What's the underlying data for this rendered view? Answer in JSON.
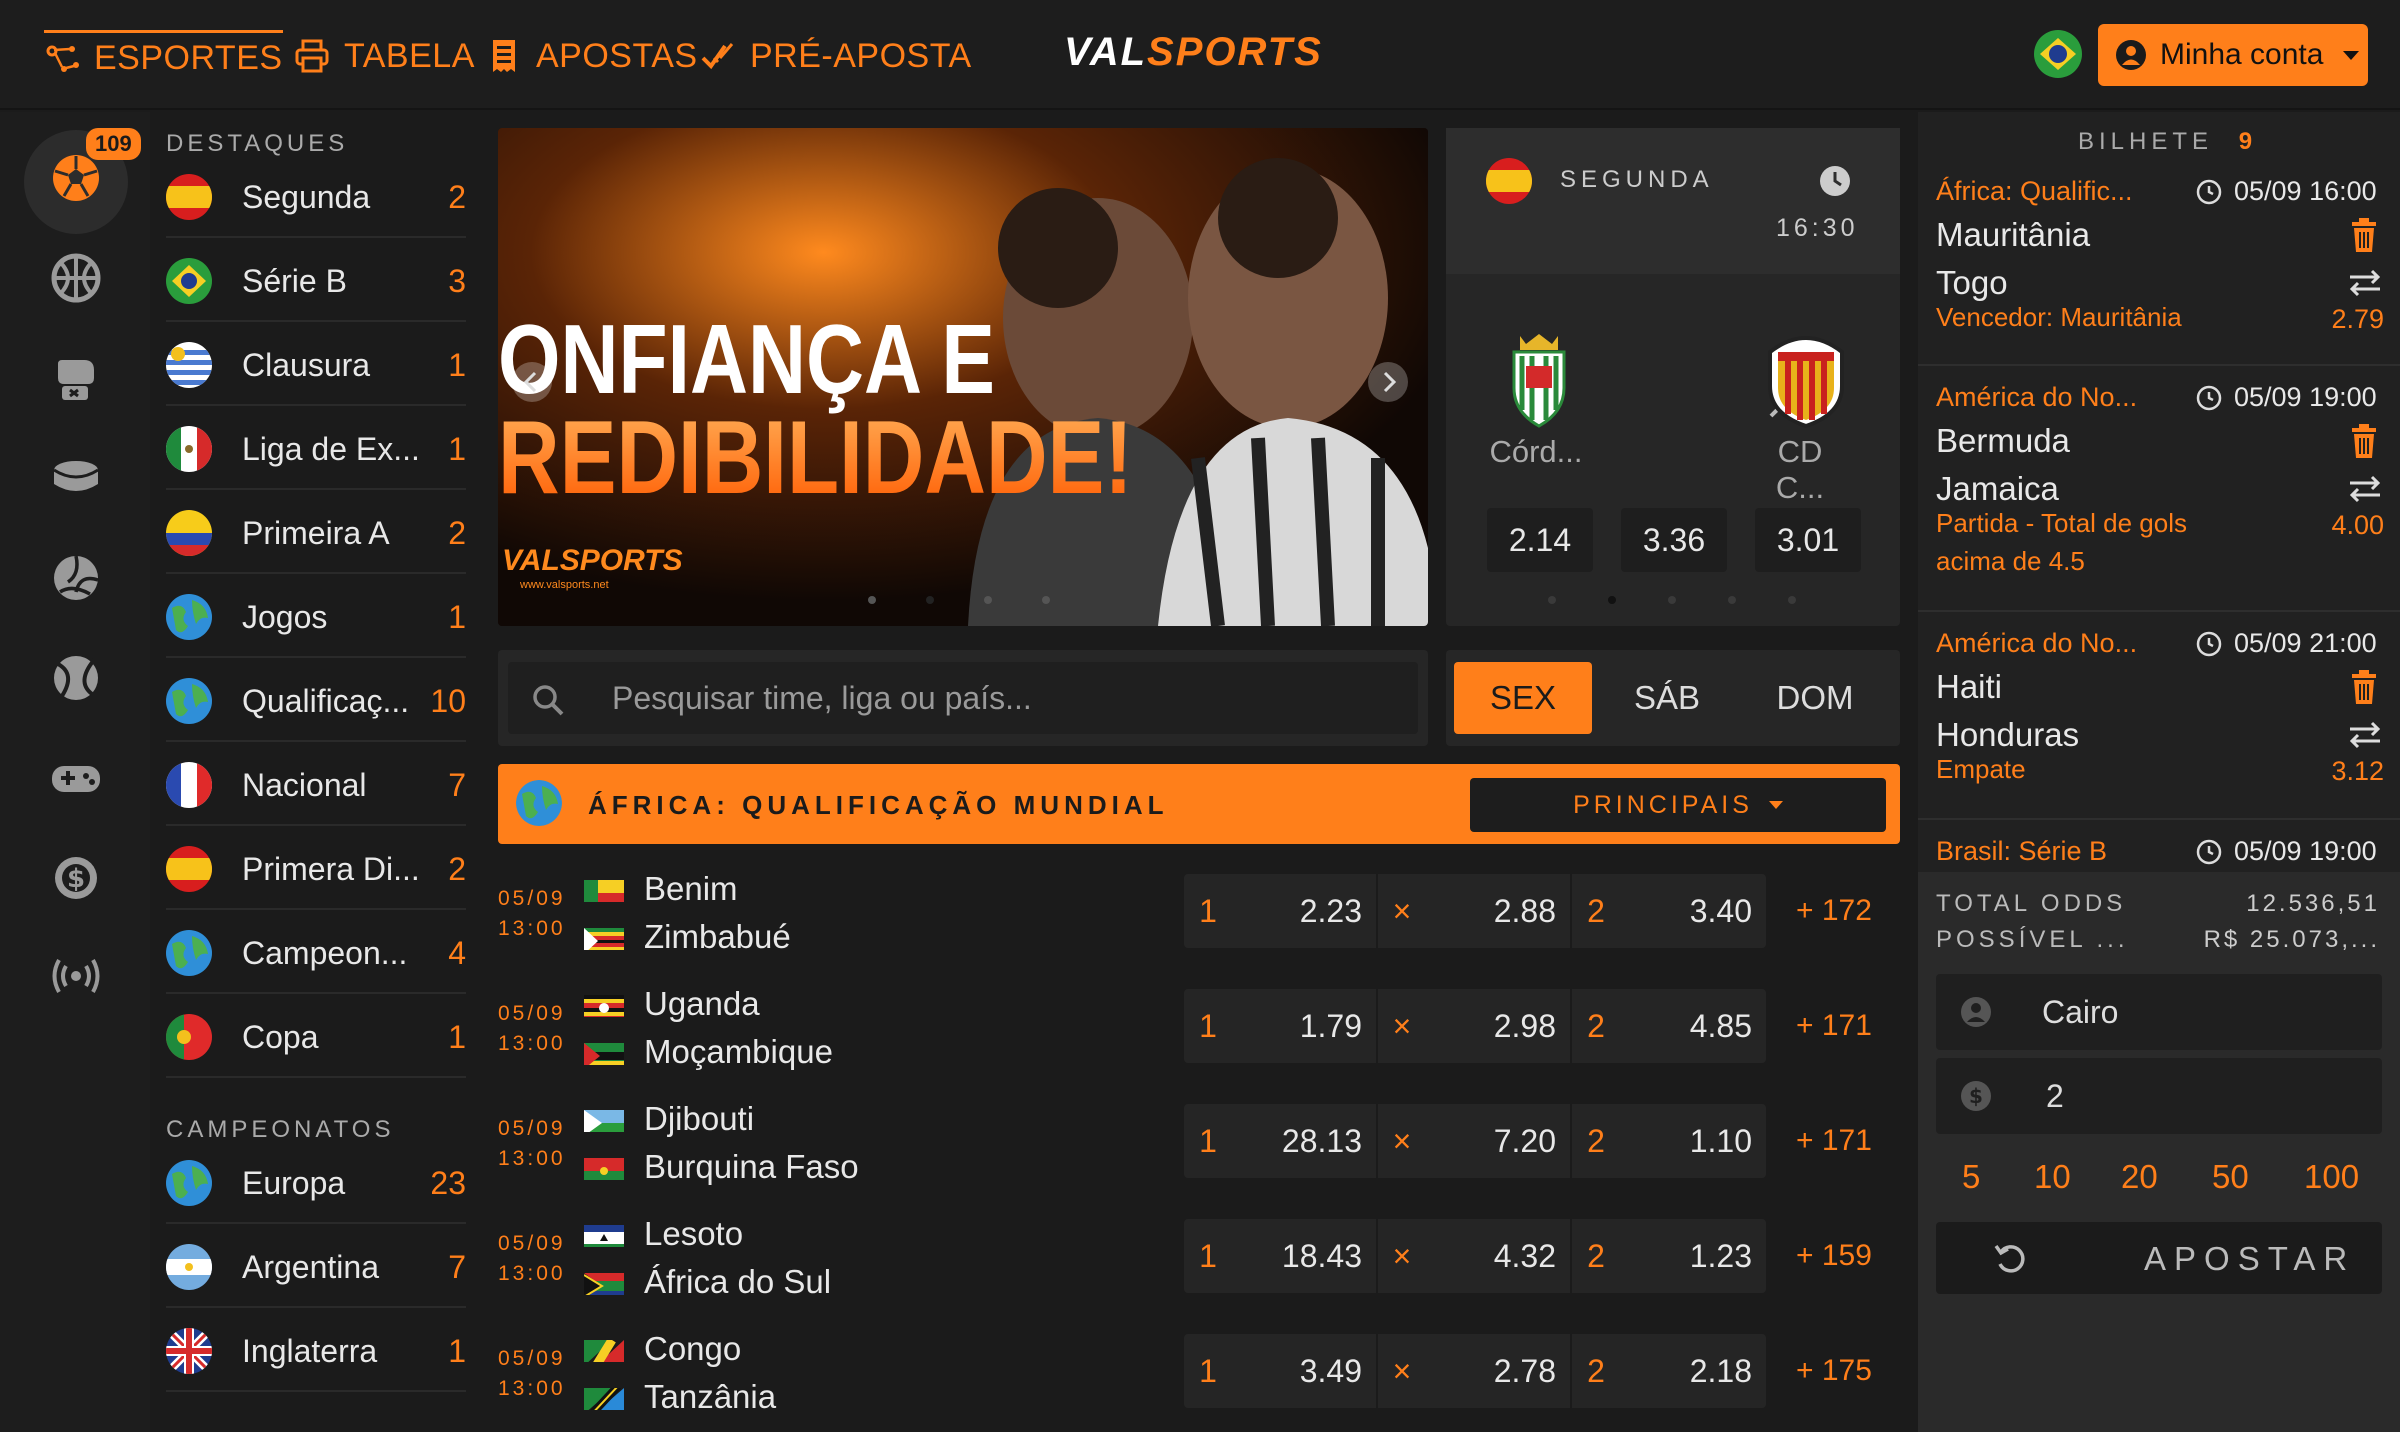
{
  "nav": {
    "esportes": "ESPORTES",
    "tabela": "TABELA",
    "apostas": "APOSTAS",
    "pre_aposta": "PRÉ-APOSTA",
    "logo_part1": "VAL",
    "logo_part2": "SPORTS",
    "account": "Minha conta"
  },
  "rail": {
    "badge": "109"
  },
  "sidebar": {
    "destaques_title": "DESTAQUES",
    "campeonatos_title": "CAMPEONATOS",
    "destaques": [
      {
        "name": "Segunda",
        "count": "2",
        "flag": "spain"
      },
      {
        "name": "Série B",
        "count": "3",
        "flag": "brazil"
      },
      {
        "name": "Clausura",
        "count": "1",
        "flag": "uruguay"
      },
      {
        "name": "Liga de Ex...",
        "count": "1",
        "flag": "mexico"
      },
      {
        "name": "Primeira A",
        "count": "2",
        "flag": "colombia"
      },
      {
        "name": "Jogos",
        "count": "1",
        "flag": "world"
      },
      {
        "name": "Qualificaç...",
        "count": "10",
        "flag": "world"
      },
      {
        "name": "Nacional",
        "count": "7",
        "flag": "france"
      },
      {
        "name": "Primera Di...",
        "count": "2",
        "flag": "spain"
      },
      {
        "name": "Campeon...",
        "count": "4",
        "flag": "world"
      },
      {
        "name": "Copa",
        "count": "1",
        "flag": "portugal"
      }
    ],
    "campeonatos": [
      {
        "name": "Europa",
        "count": "23",
        "flag": "world"
      },
      {
        "name": "Argentina",
        "count": "7",
        "flag": "argentina"
      },
      {
        "name": "Inglaterra",
        "count": "1",
        "flag": "uk"
      }
    ]
  },
  "banner": {
    "headline1": "ONFIANÇA E",
    "headline2": "REDIBILIDADE!",
    "brand": "VALSPORTS",
    "site": "www.valsports.net"
  },
  "featured": {
    "league": "SEGUNDA",
    "time": "16:30",
    "home": "Córd...",
    "away": "CD C...",
    "vs": "×",
    "odds": [
      "2.14",
      "3.36",
      "3.01"
    ]
  },
  "search": {
    "placeholder": "Pesquisar time, liga ou país..."
  },
  "days": [
    "SEX",
    "SÁB",
    "DOM"
  ],
  "competition": {
    "title": "ÁFRICA: QUALIFICAÇÃO MUNDIAL",
    "market": "PRINCIPAIS"
  },
  "matches": [
    {
      "date": "05/09",
      "time": "13:00",
      "home": "Benim",
      "away": "Zimbabué",
      "l1": "1",
      "o1": "2.23",
      "lx": "×",
      "ox": "2.88",
      "l2": "2",
      "o2": "3.40",
      "more": "+ 172"
    },
    {
      "date": "05/09",
      "time": "13:00",
      "home": "Uganda",
      "away": "Moçambique",
      "l1": "1",
      "o1": "1.79",
      "lx": "×",
      "ox": "2.98",
      "l2": "2",
      "o2": "4.85",
      "more": "+ 171"
    },
    {
      "date": "05/09",
      "time": "13:00",
      "home": "Djibouti",
      "away": "Burquina Faso",
      "l1": "1",
      "o1": "28.13",
      "lx": "×",
      "ox": "7.20",
      "l2": "2",
      "o2": "1.10",
      "more": "+ 171"
    },
    {
      "date": "05/09",
      "time": "13:00",
      "home": "Lesoto",
      "away": "África do Sul",
      "l1": "1",
      "o1": "18.43",
      "lx": "×",
      "ox": "4.32",
      "l2": "2",
      "o2": "1.23",
      "more": "+ 159"
    },
    {
      "date": "05/09",
      "time": "13:00",
      "home": "Congo",
      "away": "Tanzânia",
      "l1": "1",
      "o1": "3.49",
      "lx": "×",
      "ox": "2.78",
      "l2": "2",
      "o2": "2.18",
      "more": "+ 175"
    }
  ],
  "ticket": {
    "title": "BILHETE",
    "count": "9",
    "bets": [
      {
        "comp": "África: Qualific...",
        "datetime": "05/09 16:00",
        "home": "Mauritânia",
        "away": "Togo",
        "market": "Vencedor: Mauritânia",
        "odd": "2.79"
      },
      {
        "comp": "América do No...",
        "datetime": "05/09 19:00",
        "home": "Bermuda",
        "away": "Jamaica",
        "market": "Partida - Total de gols acima de 4.5",
        "odd": "4.00"
      },
      {
        "comp": "América do No...",
        "datetime": "05/09 21:00",
        "home": "Haiti",
        "away": "Honduras",
        "market": "Empate",
        "odd": "3.12"
      },
      {
        "comp": "Brasil: Série B",
        "datetime": "05/09 19:00"
      }
    ],
    "total_label": "TOTAL ODDS",
    "total_value": "12.536,51",
    "possible_label": "POSSÍVEL ...",
    "possible_value": "R$ 25.073,...",
    "name_value": "Cairo",
    "stake_value": "2",
    "quick": [
      "5",
      "10",
      "20",
      "50",
      "100"
    ],
    "submit": "APOSTAR"
  },
  "colors": {
    "accent": "#ff7f1a",
    "bg": "#1b1b1b",
    "panel": "#262626"
  }
}
